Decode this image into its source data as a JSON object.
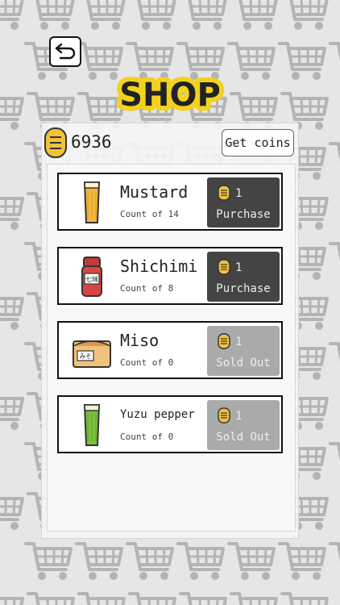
{
  "screen": {
    "title": "SHOP"
  },
  "header": {
    "coin_count": "6936",
    "get_coins_label": "Get coins"
  },
  "colors": {
    "background": "#e6e6e6",
    "title_fill": "#222222",
    "title_outline": "#f2d21e",
    "coin": "#f0c23c",
    "purchase_button": "#444444",
    "sold_out_button": "#aaaaaa"
  },
  "items": [
    {
      "name": "Mustard",
      "count_label": "Count of 14",
      "price": "1",
      "button_label": "Purchase",
      "sold_out": false,
      "icon": "mustard-glass-icon"
    },
    {
      "name": "Shichimi",
      "count_label": "Count of 8",
      "price": "1",
      "button_label": "Purchase",
      "sold_out": false,
      "icon": "shichimi-bottle-icon"
    },
    {
      "name": "Miso",
      "count_label": "Count of 0",
      "price": "1",
      "button_label": "Sold Out",
      "sold_out": true,
      "icon": "miso-container-icon"
    },
    {
      "name": "Yuzu pepper",
      "count_label": "Count of 0",
      "price": "1",
      "button_label": "Sold Out",
      "sold_out": true,
      "icon": "yuzu-pepper-glass-icon"
    }
  ],
  "icon_labels": {
    "shichimi": "七味",
    "miso": "みそ"
  }
}
